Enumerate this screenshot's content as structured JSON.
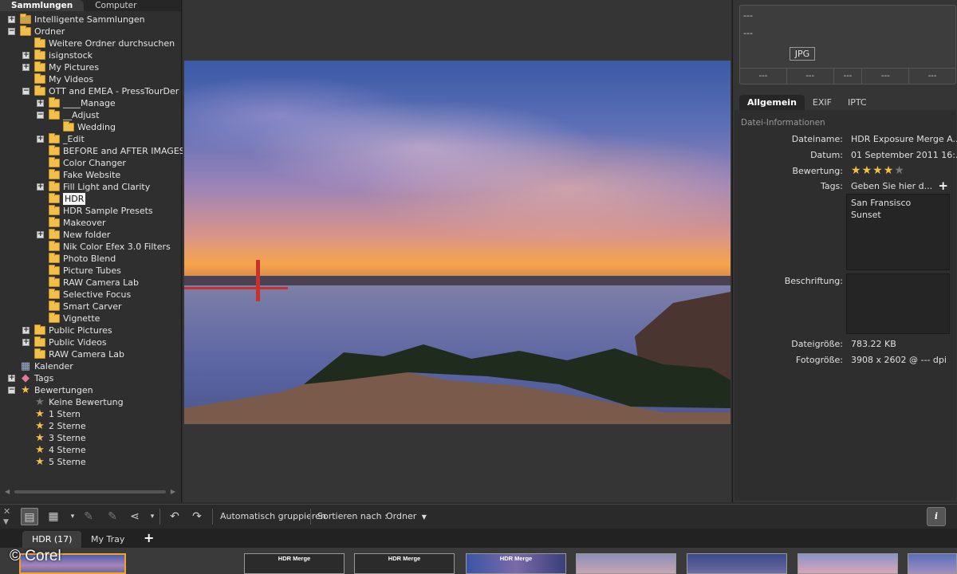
{
  "left_panel": {
    "tabs": [
      "Sammlungen",
      "Computer"
    ],
    "tree": [
      {
        "label": "Intelligente Sammlungen",
        "level": 0,
        "exp": "+",
        "icon": "smart-collection"
      },
      {
        "label": "Ordner",
        "level": 0,
        "exp": "-",
        "icon": "folder"
      },
      {
        "label": "Weitere Ordner durchsuchen",
        "level": 1,
        "exp": "",
        "icon": "add-folder"
      },
      {
        "label": "isignstock",
        "level": 1,
        "exp": "+",
        "icon": "folder"
      },
      {
        "label": "My Pictures",
        "level": 1,
        "exp": "+",
        "icon": "folder"
      },
      {
        "label": "My Videos",
        "level": 1,
        "exp": "",
        "icon": "folder"
      },
      {
        "label": "OTT and EMEA - PressTourDer",
        "level": 1,
        "exp": "-",
        "icon": "folder"
      },
      {
        "label": "____Manage",
        "level": 2,
        "exp": "+",
        "icon": "folder"
      },
      {
        "label": "__Adjust",
        "level": 2,
        "exp": "-",
        "icon": "folder"
      },
      {
        "label": "Wedding",
        "level": 3,
        "exp": "",
        "icon": "folder"
      },
      {
        "label": "_Edit",
        "level": 2,
        "exp": "+",
        "icon": "folder"
      },
      {
        "label": "BEFORE and AFTER IMAGES",
        "level": 2,
        "exp": "",
        "icon": "folder"
      },
      {
        "label": "Color Changer",
        "level": 2,
        "exp": "",
        "icon": "folder"
      },
      {
        "label": "Fake Website",
        "level": 2,
        "exp": "",
        "icon": "folder"
      },
      {
        "label": "Fill Light and Clarity",
        "level": 2,
        "exp": "+",
        "icon": "folder"
      },
      {
        "label": "HDR",
        "level": 2,
        "exp": "",
        "icon": "folder",
        "selected": true
      },
      {
        "label": "HDR Sample Presets",
        "level": 2,
        "exp": "",
        "icon": "folder"
      },
      {
        "label": "Makeover",
        "level": 2,
        "exp": "",
        "icon": "folder"
      },
      {
        "label": "New folder",
        "level": 2,
        "exp": "+",
        "icon": "folder"
      },
      {
        "label": "Nik Color Efex 3.0 Filters",
        "level": 2,
        "exp": "",
        "icon": "folder"
      },
      {
        "label": "Photo Blend",
        "level": 2,
        "exp": "",
        "icon": "folder"
      },
      {
        "label": "Picture Tubes",
        "level": 2,
        "exp": "",
        "icon": "folder"
      },
      {
        "label": "RAW Camera Lab",
        "level": 2,
        "exp": "",
        "icon": "folder"
      },
      {
        "label": "Selective Focus",
        "level": 2,
        "exp": "",
        "icon": "folder"
      },
      {
        "label": "Smart Carver",
        "level": 2,
        "exp": "",
        "icon": "folder"
      },
      {
        "label": "Vignette",
        "level": 2,
        "exp": "",
        "icon": "folder"
      },
      {
        "label": "Public Pictures",
        "level": 1,
        "exp": "+",
        "icon": "folder"
      },
      {
        "label": "Public Videos",
        "level": 1,
        "exp": "+",
        "icon": "folder"
      },
      {
        "label": "RAW Camera Lab",
        "level": 1,
        "exp": "",
        "icon": "folder"
      },
      {
        "label": "Kalender",
        "level": 0,
        "exp": "",
        "icon": "calendar"
      },
      {
        "label": "Tags",
        "level": 0,
        "exp": "+",
        "icon": "tag"
      },
      {
        "label": "Bewertungen",
        "level": 0,
        "exp": "-",
        "icon": "star"
      },
      {
        "label": "Keine Bewertung",
        "level": 1,
        "exp": "",
        "icon": "star-empty"
      },
      {
        "label": "1 Stern",
        "level": 1,
        "exp": "",
        "icon": "star"
      },
      {
        "label": "2 Sterne",
        "level": 1,
        "exp": "",
        "icon": "star"
      },
      {
        "label": "3 Sterne",
        "level": 1,
        "exp": "",
        "icon": "star"
      },
      {
        "label": "4 Sterne",
        "level": 1,
        "exp": "",
        "icon": "star"
      },
      {
        "label": "5 Sterne",
        "level": 1,
        "exp": "",
        "icon": "star"
      }
    ]
  },
  "preview": {
    "line1": "---",
    "line2": "---",
    "format": "JPG",
    "cells": [
      "---",
      "---",
      "---",
      "---",
      "---"
    ]
  },
  "right_tabs": [
    "Allgemein",
    "EXIF",
    "IPTC"
  ],
  "info": {
    "section": "Datei-Informationen",
    "filename_label": "Dateiname:",
    "filename": "HDR Exposure Merge A...",
    "date_label": "Datum:",
    "date": "01 September 2011 16:...",
    "rating_label": "Bewertung:",
    "rating": 4,
    "rating_max": 5,
    "tags_label": "Tags:",
    "tags_placeholder": "Geben Sie hier d...",
    "tags": [
      "San Fransisco",
      "Sunset"
    ],
    "caption_label": "Beschriftung:",
    "filesize_label": "Dateigröße:",
    "filesize": "783.22 KB",
    "photosize_label": "Fotogröße:",
    "photosize": "3908 x 2602 @ --- dpi"
  },
  "toolbar": {
    "auto_group": "Automatisch gruppieren",
    "sort_label": "Sortieren nach :",
    "sort_value": "Ordner"
  },
  "tray": {
    "tabs": [
      "HDR (17)",
      "My Tray"
    ],
    "thumb_label": "HDR Merge"
  },
  "watermark": "© Corel"
}
